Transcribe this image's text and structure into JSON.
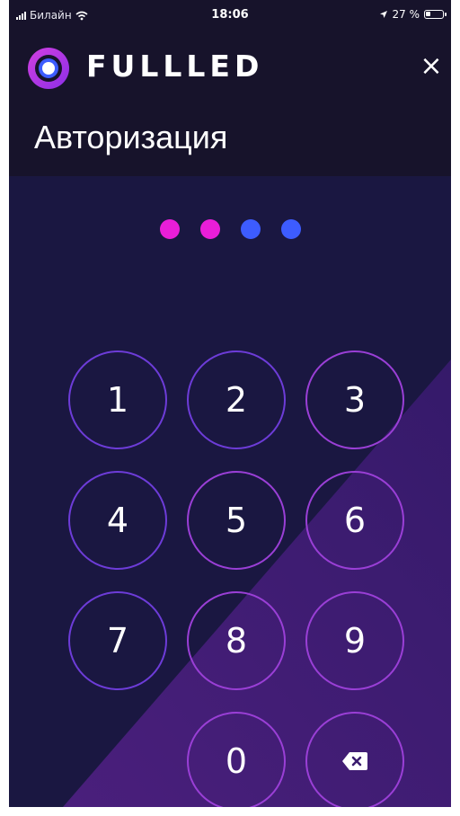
{
  "status_bar": {
    "carrier": "Билайн",
    "time": "18:06",
    "battery_percent": "27 %",
    "battery_level": 0.27
  },
  "header": {
    "brand": "FULLLED",
    "close_glyph": "×",
    "title": "Авторизация"
  },
  "pin": {
    "length": 4,
    "entered": 2,
    "filled_color": "#e91ed8",
    "empty_color": "#3d5cff"
  },
  "keypad": {
    "keys": [
      "1",
      "2",
      "3",
      "4",
      "5",
      "6",
      "7",
      "8",
      "9",
      "0"
    ],
    "backspace_icon": "backspace-icon"
  },
  "colors": {
    "background": "#1a1741",
    "header": "#17132b",
    "accent_purple": "#3b1c6e",
    "key_border": "#6d3cd8",
    "logo_outer": "#c63bdc",
    "logo_inner": "#3d5cff"
  }
}
